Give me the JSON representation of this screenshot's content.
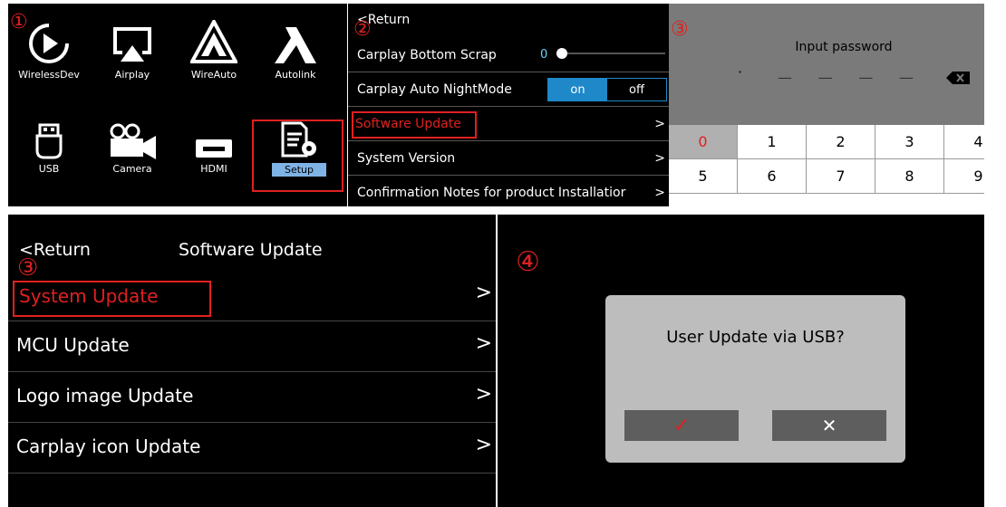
{
  "markers": {
    "m1": "①",
    "m2": "②",
    "m3a": "③",
    "m3b": "③",
    "m4": "④"
  },
  "home": {
    "apps": [
      {
        "label": "WirelessDev"
      },
      {
        "label": "Airplay"
      },
      {
        "label": "WireAuto"
      },
      {
        "label": "Autolink"
      },
      {
        "label": "USB"
      },
      {
        "label": "Camera"
      },
      {
        "label": "HDMI"
      },
      {
        "label": "Setup"
      }
    ]
  },
  "settings": {
    "return_label": "Return",
    "bottom_scrap": {
      "label": "Carplay Bottom Scrap",
      "value": "0"
    },
    "night_mode": {
      "label": "Carplay Auto NightMode",
      "on": "on",
      "off": "off",
      "selected": "on"
    },
    "software_update": "Software Update",
    "system_version": "System Version",
    "confirmation_notes": "Confirmation Notes for product Installatior",
    "chevron": ">"
  },
  "password": {
    "title": "Input password",
    "dot": "·",
    "placeholder": "—",
    "keys": [
      "0",
      "1",
      "2",
      "3",
      "4",
      "5",
      "6",
      "7",
      "8",
      "9"
    ],
    "active_key": "0",
    "accent": "#e02020"
  },
  "software_update_page": {
    "return_label": "Return",
    "title": "Software Update",
    "items": [
      {
        "label": "System Update"
      },
      {
        "label": "MCU Update"
      },
      {
        "label": "Logo image Update"
      },
      {
        "label": "Carplay icon Update"
      }
    ],
    "chevron": ">"
  },
  "dialog": {
    "message": "User Update via USB?",
    "confirm_icon": "check-icon",
    "cancel_icon": "close-icon",
    "confirm_glyph": "✓",
    "cancel_glyph": "✕"
  },
  "colors": {
    "highlight": "#e02020",
    "toggle_on": "#1e88c9",
    "setup_label_bg": "#7fb3e6"
  }
}
